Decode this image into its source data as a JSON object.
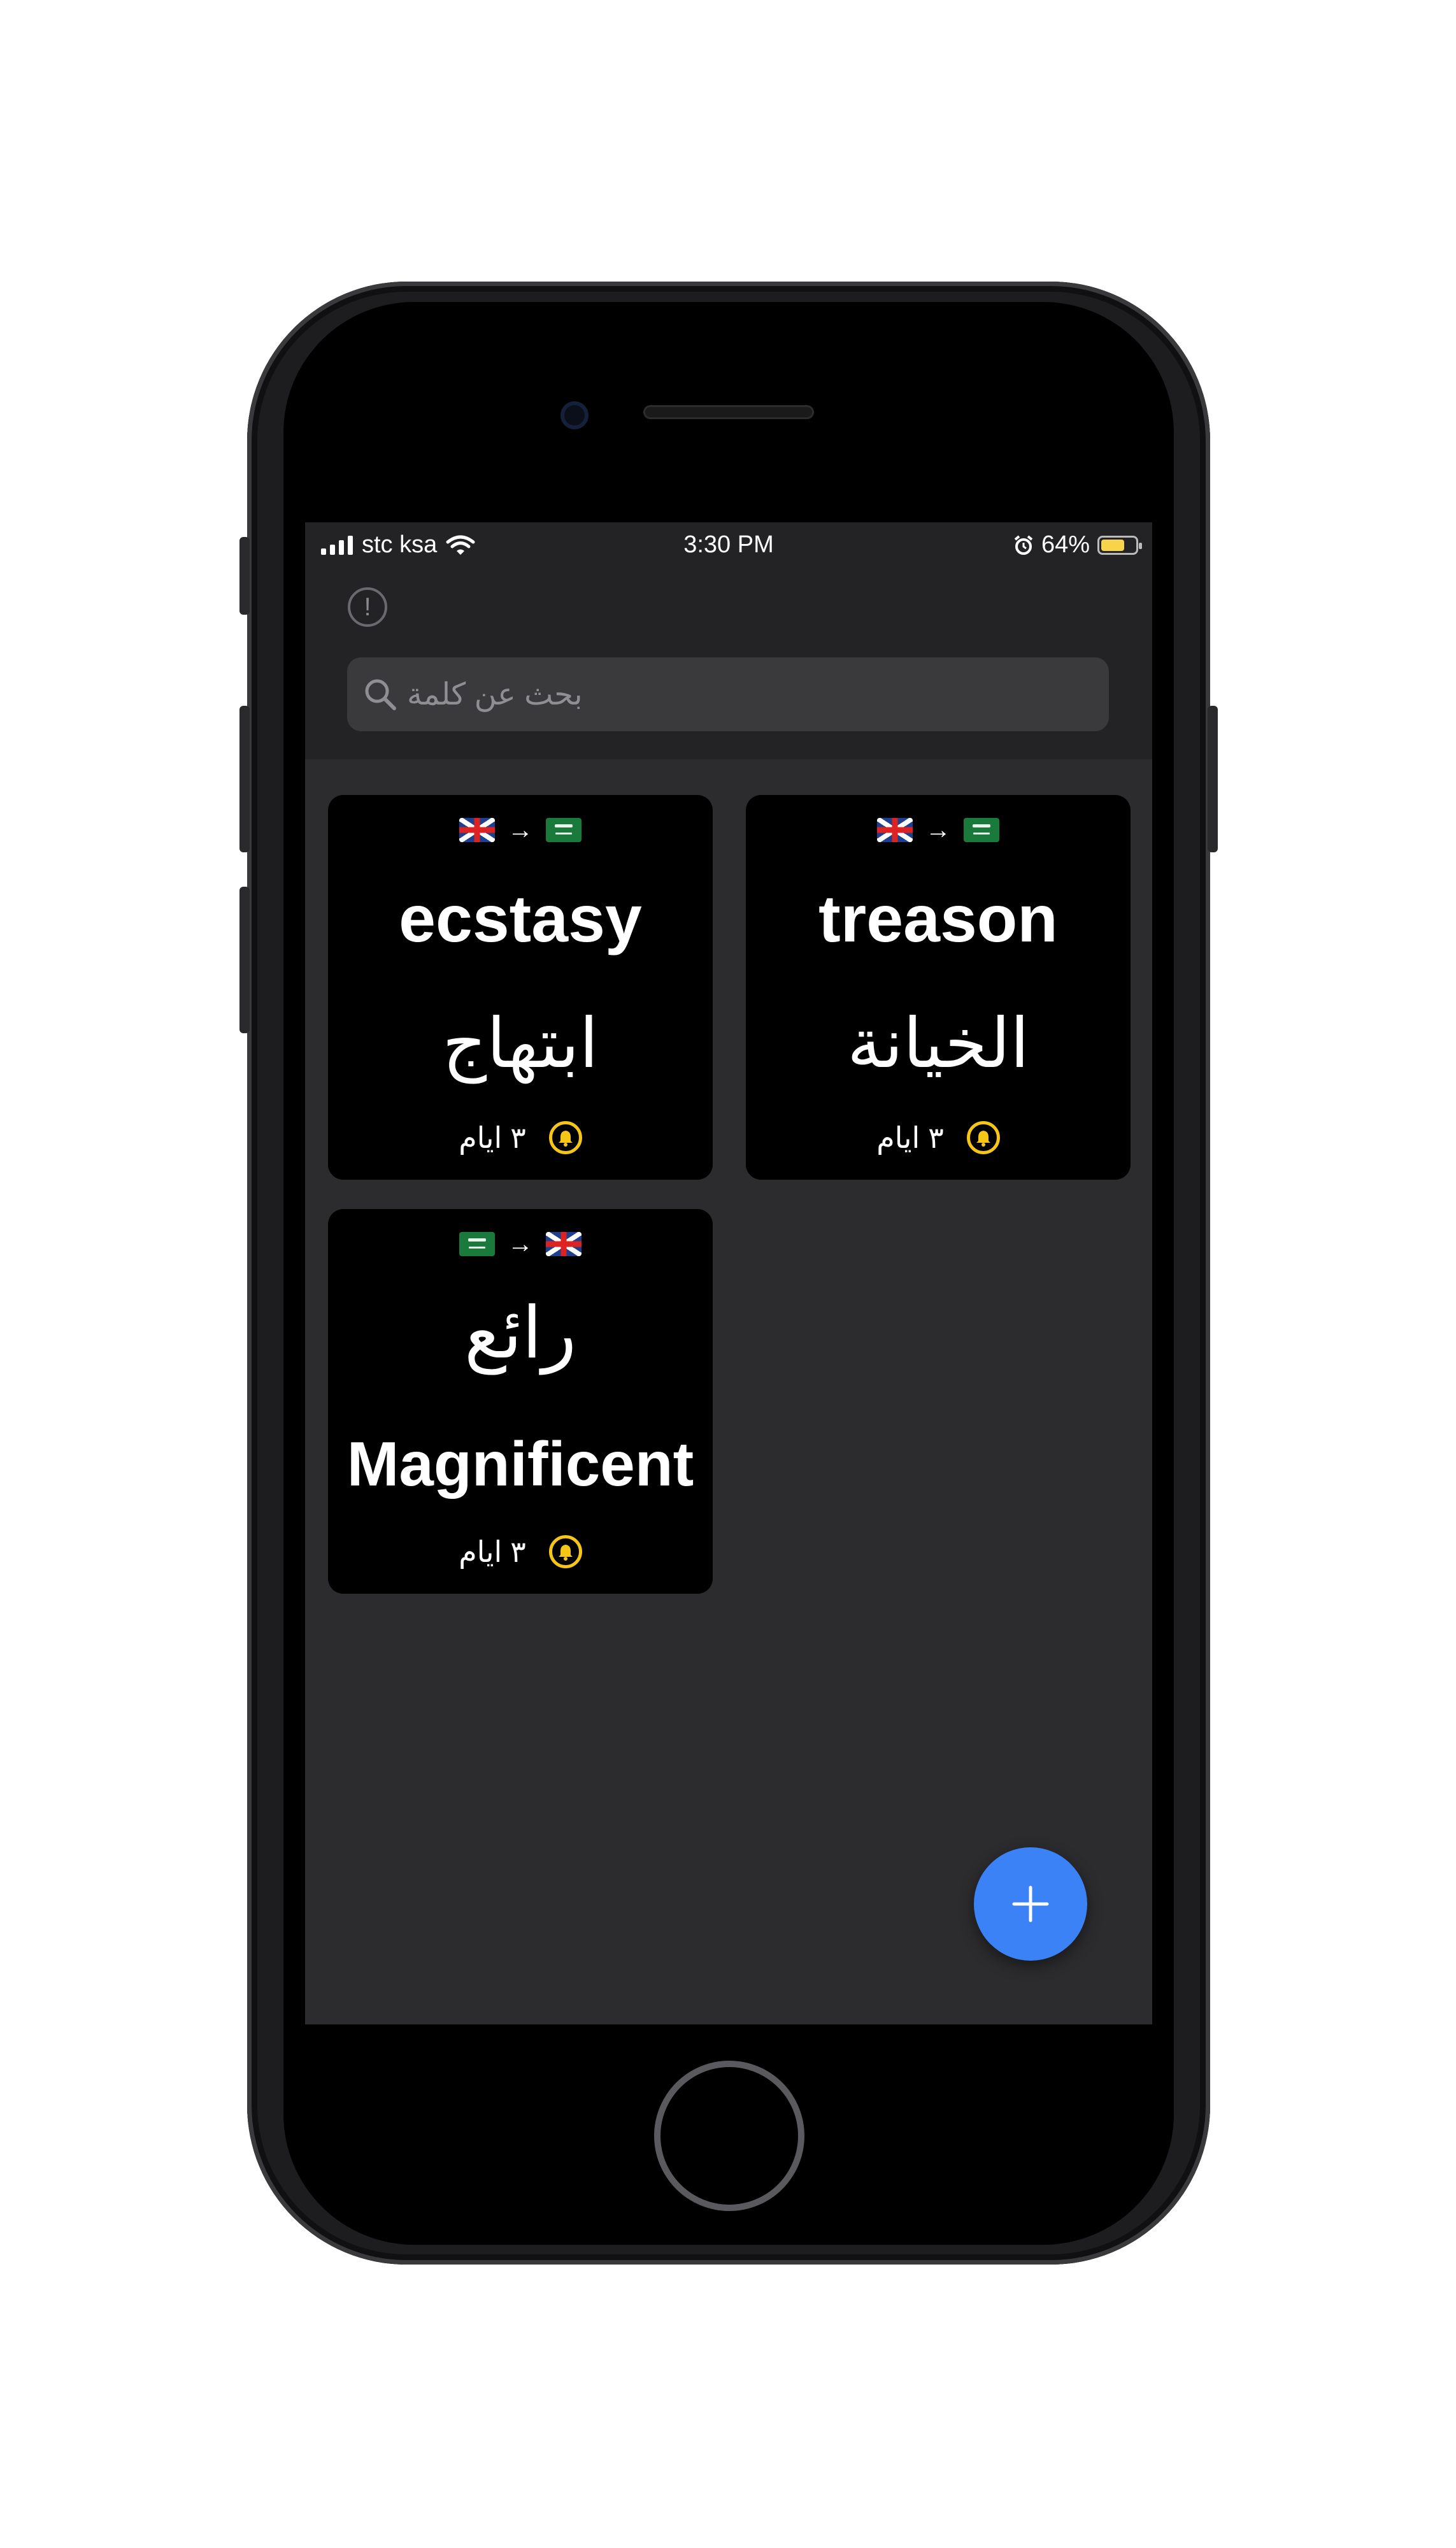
{
  "status_bar": {
    "carrier": "stc ksa",
    "time": "3:30 PM",
    "battery_percent": "64%",
    "battery_level": 0.64,
    "icons": [
      "signal-icon",
      "wifi-icon",
      "alarm-icon",
      "battery-icon"
    ]
  },
  "header": {
    "info_icon": "!",
    "search": {
      "placeholder": "بحث عن كلمة",
      "icon": "search-icon"
    }
  },
  "cards": [
    {
      "from_flag": "uk-flag",
      "to_flag": "saudi-flag",
      "word": "ecstasy",
      "translation": "ابتهاج",
      "reminder": "٣ ايام",
      "reminder_icon": "bell-icon"
    },
    {
      "from_flag": "uk-flag",
      "to_flag": "saudi-flag",
      "word": "treason",
      "translation": "الخيانة",
      "reminder": "٣ ايام",
      "reminder_icon": "bell-icon"
    },
    {
      "from_flag": "saudi-flag",
      "to_flag": "uk-flag",
      "word": "رائع",
      "translation": "Magnificent",
      "reminder": "٣ ايام",
      "reminder_icon": "bell-icon"
    }
  ],
  "fab": {
    "icon": "plus-icon"
  },
  "colors": {
    "accent": "#3b82f6",
    "bell": "#f5c518",
    "screen_background": "#2c2c2e",
    "card_background": "#000000"
  }
}
